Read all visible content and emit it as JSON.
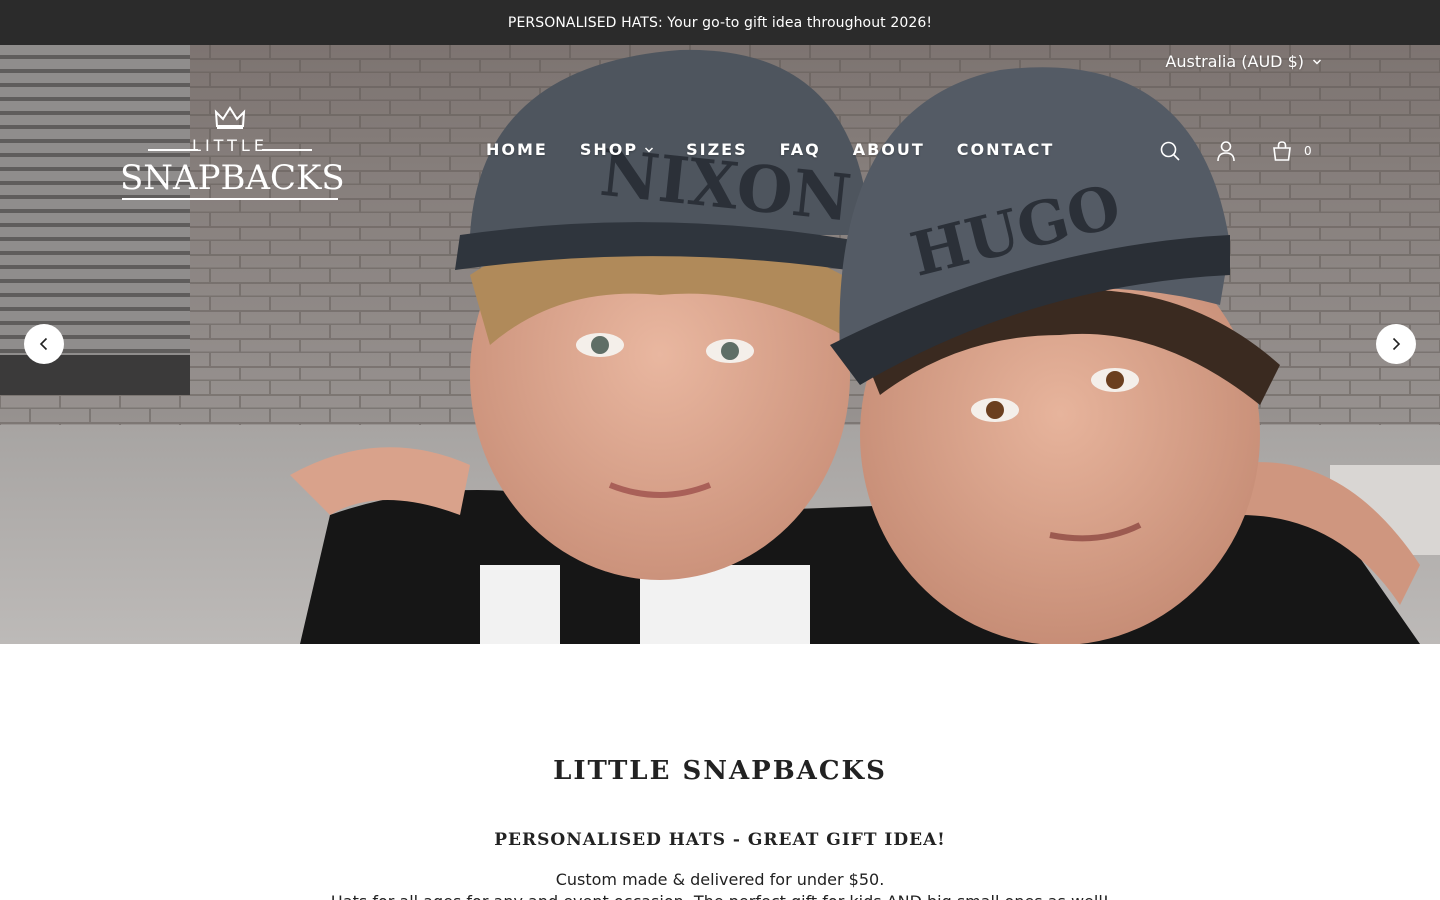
{
  "announcement": {
    "text": "PERSONALISED HATS: Your go-to gift idea throughout 2026!"
  },
  "header": {
    "currency": "Australia (AUD $)",
    "logo": {
      "top": "LITTLE",
      "main": "SNAPBACKS"
    },
    "nav": [
      {
        "label": "HOME"
      },
      {
        "label": "SHOP"
      },
      {
        "label": "SIZES"
      },
      {
        "label": "FAQ"
      },
      {
        "label": "ABOUT"
      },
      {
        "label": "CONTACT"
      }
    ],
    "cart_count": "0"
  },
  "hero": {
    "cap_left_text": "NIXON",
    "cap_right_text": "HUGO"
  },
  "intro": {
    "title": "LITTLE SNAPBACKS",
    "subtitle": "PERSONALISED HATS - GREAT GIFT IDEA!",
    "line1": "Custom made & delivered for under $50.",
    "line2": "Hats for all ages for any and event occasion. The perfect gift for kids AND big small ones as well!"
  },
  "colors": {
    "announcement_bg": "#2b2b2b",
    "text_dark": "#222222",
    "white": "#ffffff"
  },
  "icons": [
    "crown-icon",
    "chevron-down-icon",
    "search-icon",
    "account-icon",
    "cart-icon",
    "chevron-left-icon",
    "chevron-right-icon"
  ]
}
